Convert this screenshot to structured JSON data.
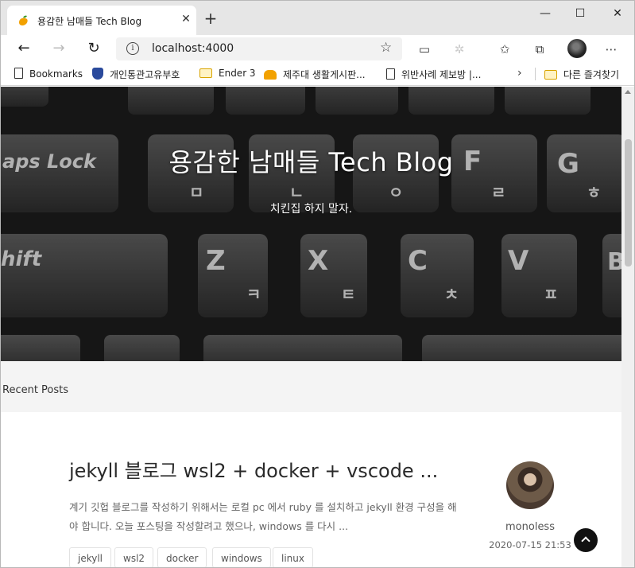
{
  "browser": {
    "tab": {
      "title": "용감한 남매들 Tech Blog",
      "favicon": "mango-icon"
    },
    "address": {
      "url": "localhost:4000"
    },
    "bookmarks": [
      {
        "label": "Bookmarks",
        "icon": "page-icon"
      },
      {
        "label": "개인통관고유부호",
        "icon": "shield-icon"
      },
      {
        "label": "Ender 3",
        "icon": "folder-icon"
      },
      {
        "label": "제주대 생활게시판...",
        "icon": "cloud-icon"
      },
      {
        "label": "위반사례 제보방 |...",
        "icon": "page-icon"
      },
      {
        "label": "다른 즐겨찾기",
        "icon": "folder-icon"
      }
    ]
  },
  "hero": {
    "title": "용감한 남매들 Tech Blog",
    "subtitle": "치킨집 하지 말자."
  },
  "section": {
    "title": "Recent Posts"
  },
  "post": {
    "title": "jekyll 블로그 wsl2 + docker + vscode ...",
    "excerpt": "계기 깃헙 블로그를 작성하기 위해서는 로컬 pc 에서 ruby 를 설치하고 jekyll 환경 구성을 해야 합니다. 오늘 포스팅을 작성할려고 했으나, windows 를 다시 ...",
    "tags": [
      "jekyll",
      "wsl2",
      "docker",
      "windows",
      "linux"
    ],
    "author": "monoless",
    "date": "2020-07-15 21:53"
  },
  "colors": {
    "accent": "#111111",
    "hero_text": "#ffffff"
  }
}
